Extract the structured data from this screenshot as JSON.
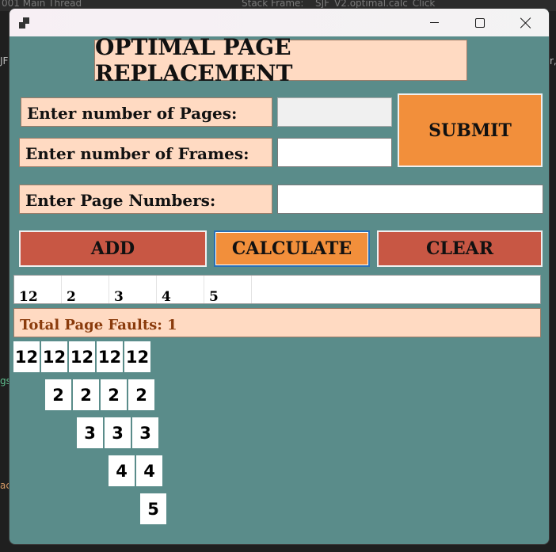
{
  "background": {
    "top_left": "001 Main Thread",
    "top_middle": "Stack Frame:",
    "top_right": "SJF_V2.optimal.calc_Click",
    "left_frag_top": "JF",
    "left_frag_mid": "gs",
    "left_frag_bot": "ac",
    "right_frag": "r,"
  },
  "window": {
    "controls": {
      "minimize": "minimize-icon",
      "maximize": "maximize-icon",
      "close": "close-icon"
    }
  },
  "form": {
    "title": "OPTIMAL PAGE REPLACEMENT",
    "pages_label": "Enter number of Pages:",
    "frames_label": "Enter number of Frames:",
    "page_numbers_label": "Enter Page Numbers:",
    "pages_value": "",
    "frames_value": "",
    "page_numbers_value": "",
    "submit_label": "SUBMIT",
    "add_label": "ADD",
    "calculate_label": "CALCULATE",
    "clear_label": "CLEAR"
  },
  "pages": [
    "12",
    "2",
    "3",
    "4",
    "5"
  ],
  "result": {
    "faults_text": "Total Page Faults: 1"
  },
  "frames_grid": [
    [
      "12",
      "12",
      "12",
      "12",
      "12"
    ],
    [
      "2",
      "2",
      "2",
      "2"
    ],
    [
      "3",
      "3",
      "3"
    ],
    [
      "4",
      "4"
    ],
    [
      "5"
    ]
  ],
  "colors": {
    "window_bg": "#5a8c8a",
    "label_bg": "#ffdac2",
    "orange": "#f28f3b",
    "red": "#c85744",
    "faults_text": "#8a3b0c"
  }
}
